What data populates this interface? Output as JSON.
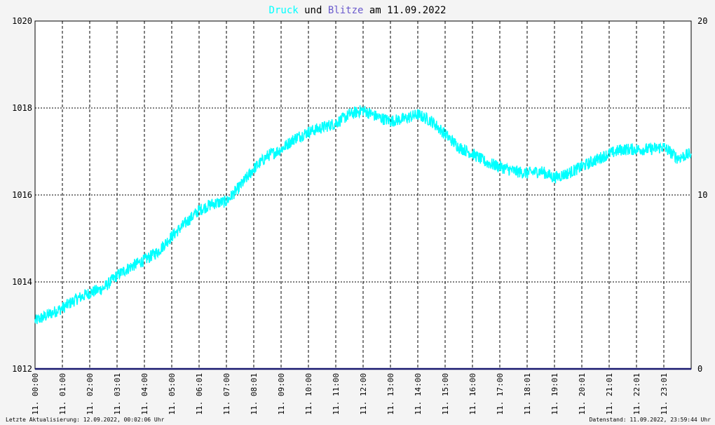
{
  "title": {
    "part1": "Druck",
    "part2": " und ",
    "part3": "Blitze",
    "part4": " am 11.09.2022",
    "color1": "#00ffff",
    "color2": "#000000",
    "color3": "#6a5acd",
    "color4": "#000000"
  },
  "footer": {
    "left": "Letzte Aktualisierung: 12.09.2022, 00:02:06 Uhr",
    "right": "Datenstand: 11.09.2022, 23:59:44 Uhr"
  },
  "colors": {
    "background": "#f4f4f4",
    "plot_background": "#ffffff",
    "pressure": "#00ffff",
    "lightning": "#191970",
    "grid": "#000000"
  },
  "chart_data": {
    "type": "line",
    "title": "Druck und Blitze am 11.09.2022",
    "x_ticks": [
      "11. 00:00",
      "11. 01:00",
      "11. 02:00",
      "11. 03:01",
      "11. 04:00",
      "11. 05:00",
      "11. 06:01",
      "11. 07:00",
      "11. 08:01",
      "11. 09:00",
      "11. 10:00",
      "11. 11:00",
      "11. 12:00",
      "11. 13:00",
      "11. 14:00",
      "11. 15:00",
      "11. 16:00",
      "11. 17:00",
      "11. 18:01",
      "11. 19:01",
      "11. 20:01",
      "11. 21:01",
      "11. 22:01",
      "11. 23:01"
    ],
    "x_range_hours": [
      0,
      24
    ],
    "y_left": {
      "ticks": [
        "1020",
        "1018",
        "1016",
        "1014",
        "1012"
      ],
      "range": [
        1012,
        1020
      ]
    },
    "y_right": {
      "ticks": [
        "20",
        "10",
        "0"
      ],
      "range": [
        0,
        20
      ]
    },
    "grid": true,
    "series": [
      {
        "name": "Druck",
        "axis": "left",
        "color": "#00ffff",
        "x_hours": [
          0,
          0.5,
          1,
          1.5,
          2,
          2.5,
          3,
          3.5,
          4,
          4.5,
          5,
          5.5,
          6,
          6.5,
          7,
          7.5,
          8,
          8.5,
          9,
          9.5,
          10,
          10.5,
          11,
          11.5,
          12,
          12.5,
          13,
          13.5,
          14,
          14.5,
          15,
          15.5,
          16,
          16.5,
          17,
          17.5,
          18,
          18.5,
          19,
          19.5,
          20,
          20.5,
          21,
          21.5,
          22,
          22.5,
          23,
          23.5,
          24
        ],
        "values": [
          1013.1,
          1013.25,
          1013.4,
          1013.6,
          1013.75,
          1013.85,
          1014.15,
          1014.35,
          1014.5,
          1014.7,
          1015.05,
          1015.35,
          1015.65,
          1015.8,
          1015.85,
          1016.2,
          1016.6,
          1016.9,
          1017.05,
          1017.3,
          1017.45,
          1017.55,
          1017.65,
          1017.85,
          1017.95,
          1017.8,
          1017.7,
          1017.75,
          1017.85,
          1017.7,
          1017.4,
          1017.1,
          1016.95,
          1016.75,
          1016.65,
          1016.55,
          1016.5,
          1016.55,
          1016.4,
          1016.5,
          1016.65,
          1016.8,
          1016.95,
          1017.05,
          1017.05,
          1017.05,
          1017.1,
          1016.85,
          1016.95
        ]
      },
      {
        "name": "Blitze",
        "axis": "right",
        "color": "#191970",
        "x_hours": [
          0,
          24
        ],
        "values": [
          0,
          0
        ]
      }
    ]
  }
}
